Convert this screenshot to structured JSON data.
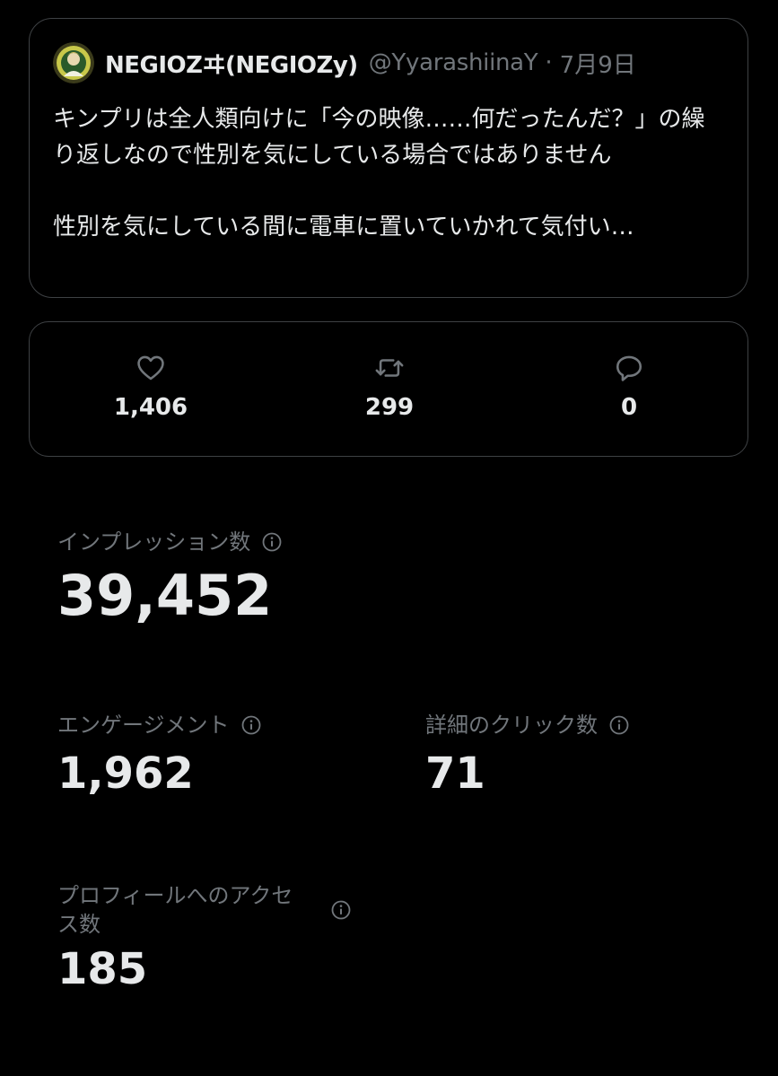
{
  "tweet": {
    "display_name": "NEGIOZヰ(NEGIOZy)",
    "handle": "@YyarashiinaY",
    "separator": "·",
    "date": "7月9日",
    "text": "キンプリは全人類向けに「今の映像……何だったんだ？」の繰り返しなので性別を気にしている場合ではありません\n\n性別を気にしている間に電車に置いていかれて気付い…"
  },
  "stats": {
    "likes": "1,406",
    "retweets": "299",
    "replies": "0"
  },
  "metrics": {
    "impressions": {
      "label": "インプレッション数",
      "value": "39,452"
    },
    "engagements": {
      "label": "エンゲージメント",
      "value": "1,962"
    },
    "detail_clicks": {
      "label": "詳細のクリック数",
      "value": "71"
    },
    "profile_visits": {
      "label_line1": "プロフィールへのアクセ",
      "label_line2": "ス数",
      "value": "185"
    }
  },
  "colors": {
    "background": "#000000",
    "text_primary": "#e7e9ea",
    "text_secondary": "#71767b",
    "border": "#3e4144"
  }
}
